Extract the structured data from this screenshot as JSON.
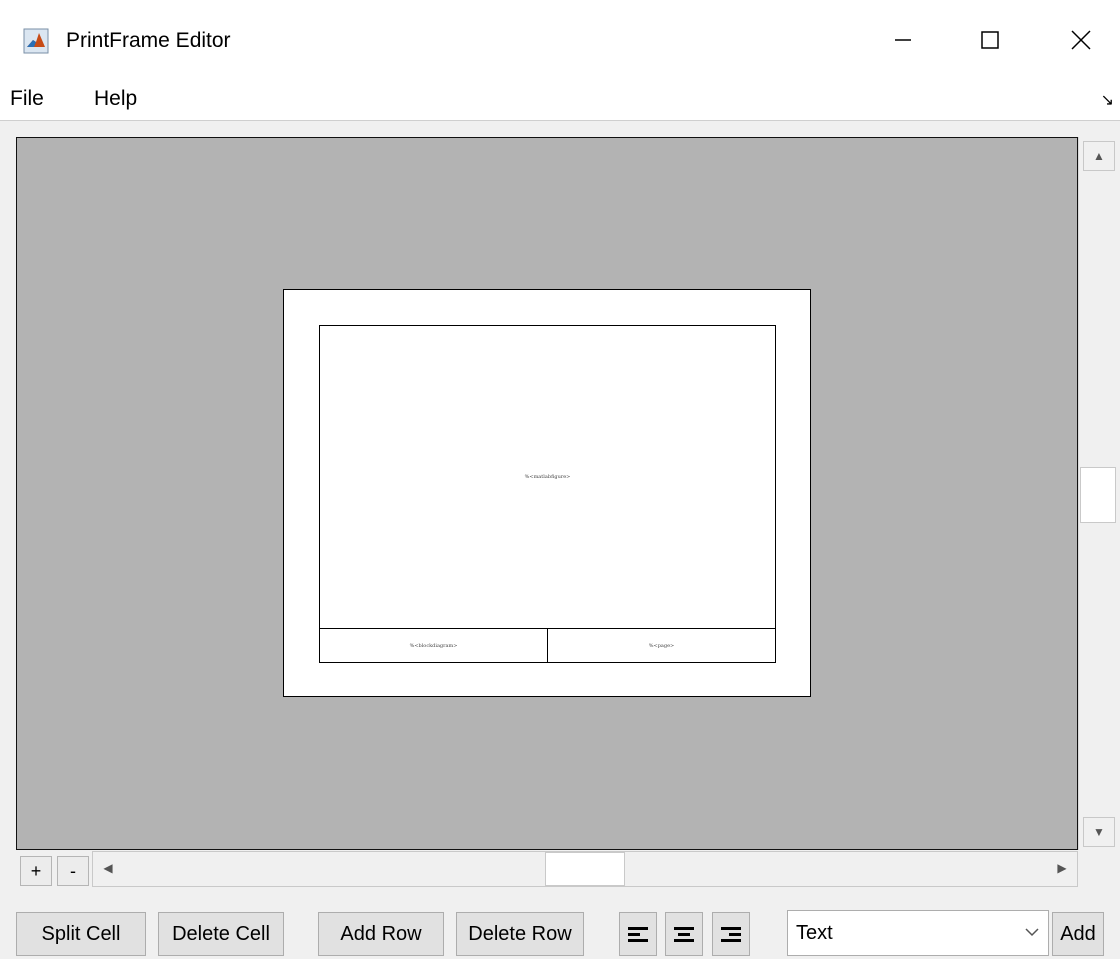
{
  "window": {
    "title": "PrintFrame Editor",
    "icon": "matlab-logo-icon"
  },
  "menu": {
    "items": [
      "File",
      "Help"
    ]
  },
  "frame": {
    "main_cell_text": "%<matlabfigure>",
    "left_cell_text": "%<blockdiagram>",
    "right_cell_text": "%<page>"
  },
  "zoom": {
    "plus_label": "+",
    "minus_label": "-"
  },
  "toolbar": {
    "split_cell": "Split Cell",
    "delete_cell": "Delete Cell",
    "add_row": "Add Row",
    "delete_row": "Delete Row",
    "content_type": "Text",
    "add": "Add"
  },
  "colors": {
    "canvas": "#b3b3b3",
    "page": "#ffffff"
  }
}
